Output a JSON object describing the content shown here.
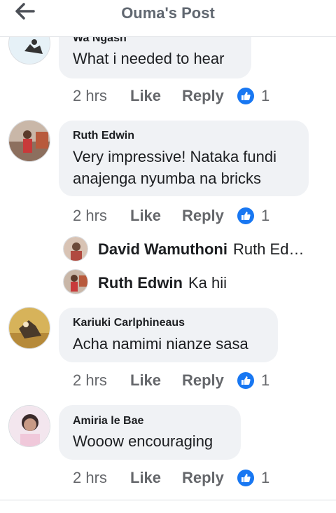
{
  "header": {
    "title": "Ouma's Post"
  },
  "comments": [
    {
      "author": "Wa Ngash",
      "text": "What i needed to hear",
      "time": "2 hrs",
      "like": "Like",
      "reply": "Reply",
      "reactions": "1"
    },
    {
      "author": "Ruth Edwin",
      "text_line1": "Very impressive! Nataka fundi",
      "text_line2": "anajenga nyumba na bricks",
      "time": "2 hrs",
      "like": "Like",
      "reply": "Reply",
      "reactions": "1"
    },
    {
      "author": "Kariuki Carlphineaus",
      "text": "Acha namimi nianze sasa",
      "time": "2 hrs",
      "like": "Like",
      "reply": "Reply",
      "reactions": "1"
    },
    {
      "author": "Amiria le Bae",
      "text": "Wooow encouraging",
      "time": "2 hrs",
      "like": "Like",
      "reply": "Reply",
      "reactions": "1"
    }
  ],
  "replies": [
    {
      "author": "David Wamuthoni",
      "text": "Ruth Ed…"
    },
    {
      "author": "Ruth Edwin",
      "text": "Ka hii"
    }
  ],
  "colors": {
    "reaction_blue": "#1877f2",
    "bubble": "#f0f2f5",
    "meta": "#65676b"
  }
}
